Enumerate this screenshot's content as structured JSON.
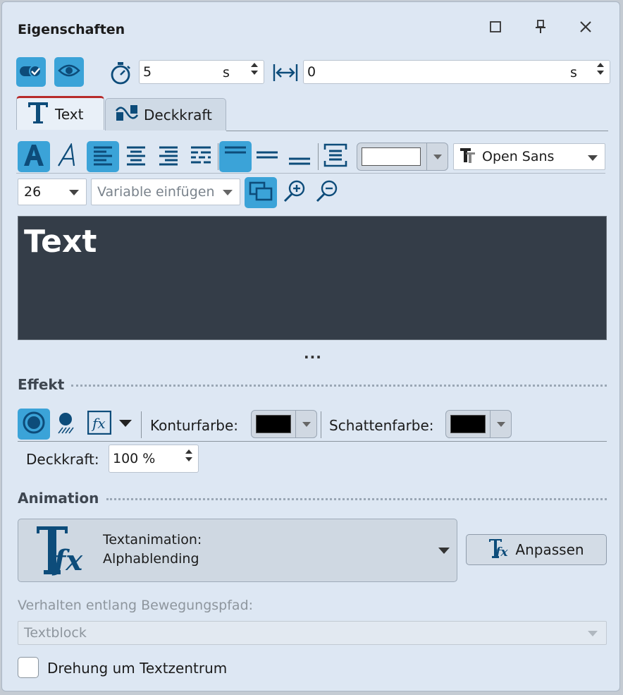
{
  "window": {
    "title": "Eigenschaften"
  },
  "timing": {
    "duration_value": "5",
    "duration_unit": "s",
    "offset_value": "0",
    "offset_unit": "s"
  },
  "tabs": [
    {
      "label": "Text"
    },
    {
      "label": "Deckkraft"
    }
  ],
  "format": {
    "color_swatch": "#ffffff",
    "font_name": "Open Sans",
    "font_size": "26",
    "variable_placeholder": "Variable einfügen"
  },
  "preview": {
    "text": "Text"
  },
  "more_dots": "...",
  "effect": {
    "section_label": "Effekt",
    "contour_label": "Konturfarbe:",
    "contour_color": "#000000",
    "shadow_label": "Schattenfarbe:",
    "shadow_color": "#000000",
    "opacity_label": "Deckkraft:",
    "opacity_value": "100 %"
  },
  "animation": {
    "section_label": "Animation",
    "type_label": "Textanimation:",
    "type_value": "Alphablending",
    "adjust_button": "Anpassen",
    "motion_path_label": "Verhalten entlang Bewegungspfad:",
    "motion_path_value": "Textblock",
    "rotation_label": "Drehung um Textzentrum"
  },
  "colors": {
    "accent": "#3ba3d8",
    "icon": "#0d4c7a",
    "tab_active_border": "#b72b2b",
    "preview_bg": "#343d48"
  }
}
